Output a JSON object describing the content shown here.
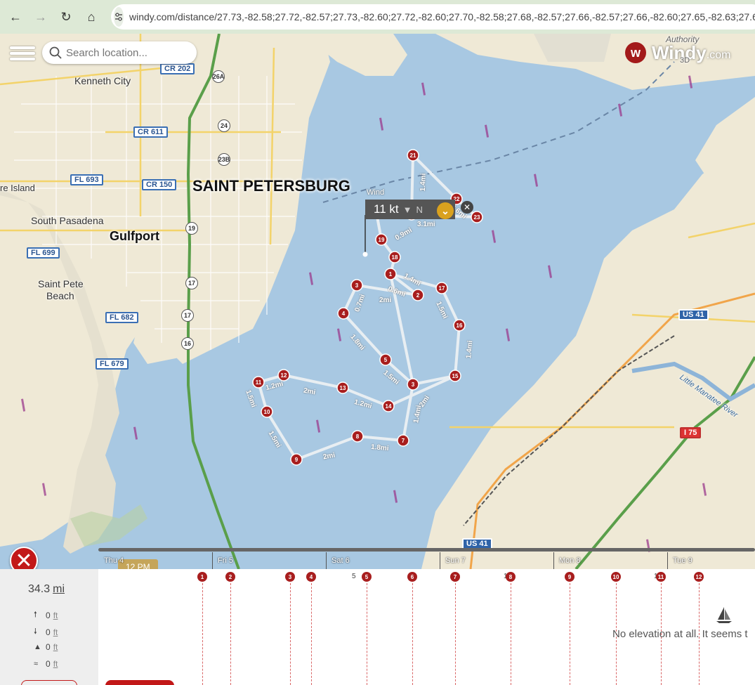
{
  "browser": {
    "url": "windy.com/distance/27.73,-82.58;27.72,-82.57;27.73,-82.60;27.72,-82.60;27.70,-82.58;27.68,-82.57;27.66,-82.57;27.66,-82.60;27.65,-82.63;27.67,-8"
  },
  "search": {
    "placeholder": "Search location..."
  },
  "logo": {
    "word": "Windy",
    "suffix": ".com",
    "credit1": "Authority",
    "credit2": "3D"
  },
  "map": {
    "labels": {
      "kenneth_city": "Kenneth City",
      "south_pasadena": "South Pasadena",
      "saint_pete_beach_1": "Saint Pete",
      "saint_pete_beach_2": "Beach",
      "treasure_island": "re Island",
      "saint_petersburg": "SAINT PETERSBURG",
      "gulfport": "Gulfport",
      "little_manatee": "Little Manatee River"
    },
    "shields": {
      "cr202": "CR 202",
      "cr611": "CR 611",
      "fl693": "FL 693",
      "cr150": "CR 150",
      "fl699": "FL 699",
      "fl682": "FL 682",
      "fl679": "FL 679",
      "us41a": "US 41",
      "us41b": "US 41",
      "i75": "I 75"
    },
    "route_badges": {
      "b26a": "26A",
      "b24": "24",
      "b23b": "23B",
      "b19": "19",
      "b17": "17",
      "b17b": "17",
      "b16": "16"
    },
    "segment_labels": [
      "1.4mi",
      "3.1mi",
      "0.6mi",
      "0.9mi",
      "1.4mi",
      "0.6mi",
      "2mi",
      "0.7mi",
      "1.5mi",
      "1.8mi",
      "1.4mi",
      "1.5mi",
      "1.2mi",
      "2mi",
      "1.2mi",
      "2mi",
      "1.5mi",
      "1.5mi",
      "2mi",
      "1.8mi",
      "1.4mi"
    ]
  },
  "wind": {
    "title": "Wind",
    "speed": "11 kt",
    "dir": "N"
  },
  "time_bubble": "12 PM",
  "timeline": {
    "days": [
      "Thu 4",
      "Fri 5",
      "Sat 6",
      "Sun 7",
      "Mon 8",
      "Tue 9"
    ]
  },
  "stats": {
    "distance": "34.3",
    "distance_unit": "mi",
    "rows": [
      {
        "icon": "up-arrow-icon",
        "value": "0",
        "unit": "ft"
      },
      {
        "icon": "down-arrow-icon",
        "value": "0",
        "unit": "ft"
      },
      {
        "icon": "mountain-icon",
        "value": "0",
        "unit": "ft"
      },
      {
        "icon": "waves-icon",
        "value": "0",
        "unit": "ft"
      }
    ]
  },
  "graph": {
    "waypoints": [
      "1",
      "2",
      "3",
      "4",
      "5",
      "6",
      "7",
      "8",
      "9",
      "10",
      "11",
      "12"
    ],
    "ticks": [
      "5",
      "1",
      "1"
    ],
    "no_elevation": "No elevation at all. It seems t"
  },
  "colors": {
    "route_marker": "#a81e1e",
    "water": "#a8c8e2",
    "land": "#efe9d6",
    "chrome": "#dde9d6"
  }
}
